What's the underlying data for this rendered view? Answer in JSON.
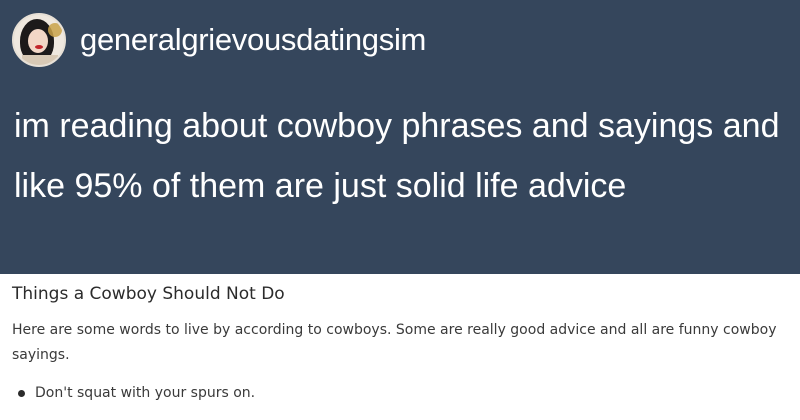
{
  "post": {
    "username": "generalgrievousdatingsim",
    "body": "im reading about cowboy phrases and sayings and like 95% of them are just solid life advice"
  },
  "quote": {
    "title": "Things a Cowboy Should Not Do",
    "intro": "Here are some words to live by according to cowboys. Some are really good advice and all are funny cowboy sayings.",
    "items": [
      "Don't squat with your spurs on."
    ]
  }
}
